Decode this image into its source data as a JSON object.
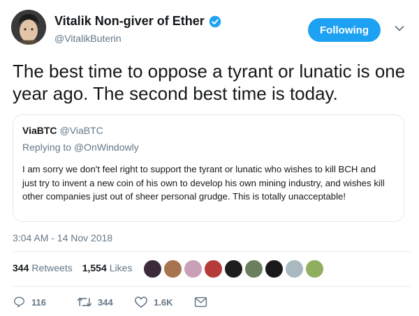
{
  "author": {
    "name": "Vitalik Non-giver of Ether",
    "handle": "@VitalikButerin"
  },
  "follow_button": "Following",
  "tweet_text": "The best time to oppose a tyrant or lunatic is one year ago. The second best time is today.",
  "quoted_tweet": {
    "author_name": "ViaBTC",
    "author_handle": "@ViaBTC",
    "replying_to": "Replying to @OnWindowly",
    "body": "I am sorry we don't feel right to support the tyrant or lunatic who wishes to kill BCH and just try to invent a new coin of his own to develop his own mining industry, and wishes kill other companies just out of sheer personal grudge. This is totally unacceptable!"
  },
  "timestamp": "3:04 AM - 14 Nov 2018",
  "stats": {
    "retweets_count": "344",
    "retweets_label": "Retweets",
    "likes_count": "1,554",
    "likes_label": "Likes"
  },
  "liker_colors": [
    "#3b2b3a",
    "#a8744f",
    "#c9a0b8",
    "#b53a3a",
    "#1e1e1e",
    "#6b7f5e",
    "#1a1a1a",
    "#aab8c2",
    "#8fae5e"
  ],
  "actions": {
    "replies": "116",
    "retweets": "344",
    "likes": "1.6K"
  },
  "colors": {
    "accent": "#1da1f2",
    "muted": "#657786",
    "text": "#14171a"
  }
}
